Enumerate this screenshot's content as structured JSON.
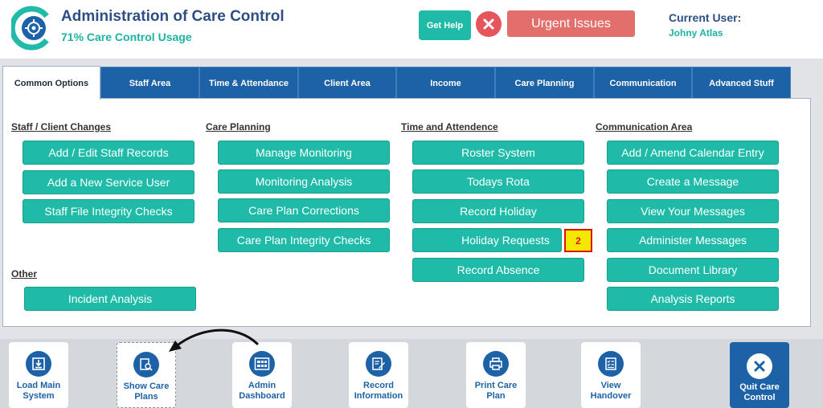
{
  "header": {
    "title": "Administration of Care Control",
    "usage": "71% Care Control Usage",
    "help_label": "Get Help",
    "urgent_label": "Urgent Issues",
    "user_label": "Current User:",
    "user_name": "Johny Atlas"
  },
  "tabs": [
    {
      "label": "Common Options",
      "active": true
    },
    {
      "label": "Staff Area"
    },
    {
      "label": "Time & Attendance"
    },
    {
      "label": "Client Area"
    },
    {
      "label": "Income"
    },
    {
      "label": "Care Planning"
    },
    {
      "label": "Communication"
    },
    {
      "label": "Advanced Stuff"
    }
  ],
  "sections": {
    "staff": {
      "title": "Staff / Client Changes",
      "buttons": [
        "Add / Edit Staff Records",
        "Add a New Service User",
        "Staff File Integrity Checks"
      ]
    },
    "other": {
      "title": "Other",
      "buttons": [
        "Incident Analysis"
      ]
    },
    "care": {
      "title": "Care Planning",
      "buttons": [
        "Manage Monitoring",
        "Monitoring Analysis",
        "Care Plan Corrections",
        "Care Plan Integrity Checks"
      ]
    },
    "time": {
      "title": "Time and Attendence",
      "buttons": [
        "Roster System",
        "Todays Rota",
        "Record Holiday",
        "Holiday Requests",
        "Record Absence"
      ],
      "holiday_badge": "2"
    },
    "comm": {
      "title": "Communication Area",
      "buttons": [
        "Add / Amend Calendar Entry",
        "Create a Message",
        "View Your Messages",
        "Administer Messages",
        "Document Library",
        "Analysis Reports"
      ]
    }
  },
  "toolbar": [
    {
      "line1": "Load Main",
      "line2": "System",
      "icon": "download-icon"
    },
    {
      "line1": "Show Care",
      "line2": "Plans",
      "icon": "search-document-icon",
      "selected": true
    },
    {
      "line1": "Admin",
      "line2": "Dashboard",
      "icon": "dashboard-icon"
    },
    {
      "line1": "Record",
      "line2": "Information",
      "icon": "edit-document-icon"
    },
    {
      "line1": "Print Care",
      "line2": "Plan",
      "icon": "printer-icon"
    },
    {
      "line1": "View",
      "line2": "Handover",
      "icon": "checklist-icon"
    },
    {
      "line1": "Quit Care",
      "line2": "Control",
      "icon": "close-icon"
    }
  ],
  "colors": {
    "teal": "#1fbba8",
    "navy": "#1d62a7",
    "urgent": "#e36f6c",
    "badge": "#f4e800"
  }
}
